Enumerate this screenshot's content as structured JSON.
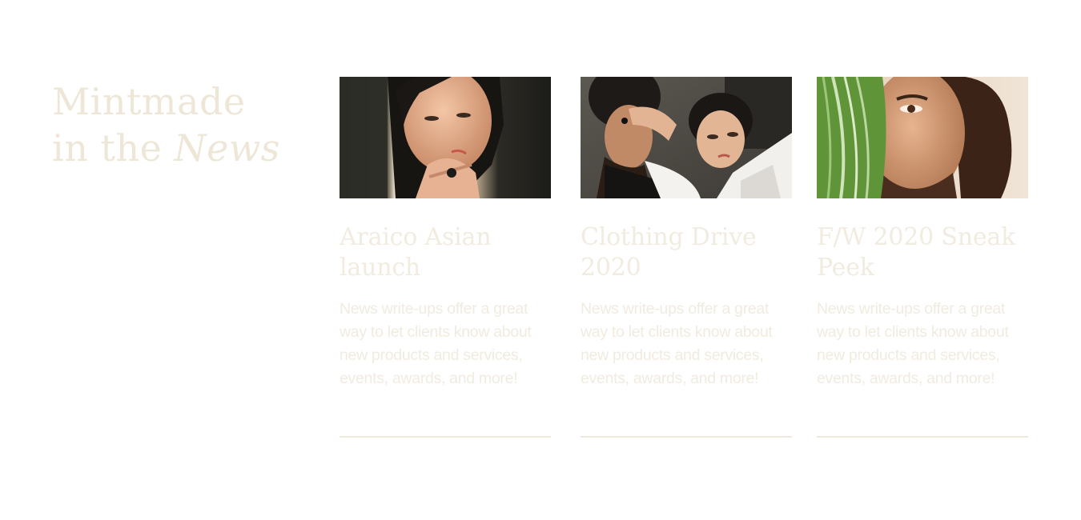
{
  "section": {
    "heading_line1": "Mintmade",
    "heading_line2_prefix": "in the",
    "heading_line2_italic": "News"
  },
  "cards": [
    {
      "image": "portrait-woman-hand-on-lips-photo",
      "title": "Araico Asian launch",
      "description": "News write-ups offer a great way to let clients know about new products and services, events, awards, and more!"
    },
    {
      "image": "couple-fashion-photo",
      "title": "Clothing Drive 2020",
      "description": "News write-ups offer a great way to let clients know about new products and services, events, awards, and more!"
    },
    {
      "image": "man-behind-leaf-photo",
      "title": "F/W 2020 Sneak Peek",
      "description": "News write-ups offer a great way to let clients know about new products and services, events, awards, and more!"
    }
  ],
  "colors": {
    "text": "#f1ebe0",
    "heading": "#eee7d8",
    "rule": "#efe9dd",
    "background": "#ffffff"
  }
}
